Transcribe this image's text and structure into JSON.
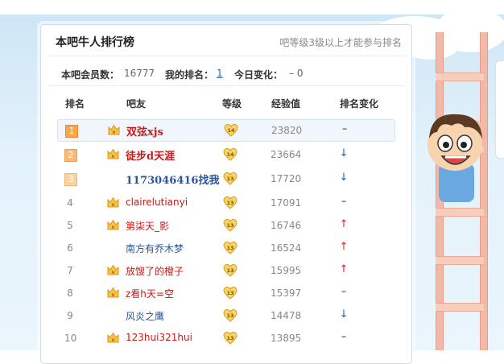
{
  "panel": {
    "title": "本吧牛人排行榜",
    "note": "吧等级3级以上才能参与排名"
  },
  "stats": {
    "members_label": "本吧会员数：",
    "members_value": "16777",
    "my_rank_label": "我的排名：",
    "my_rank_value": "1",
    "today_label": "今日变化：",
    "today_value": "– 0"
  },
  "table": {
    "headers": [
      "排名",
      "吧友",
      "等级",
      "经验值",
      "排名变化"
    ],
    "rows": [
      {
        "rank": "1",
        "name": "双弦xjs",
        "vip": true,
        "level": "14",
        "exp": "23820",
        "change": "same"
      },
      {
        "rank": "2",
        "name": "徒步d天涯",
        "vip": true,
        "level": "14",
        "exp": "23664",
        "change": "down"
      },
      {
        "rank": "3",
        "name": "1173046416找我",
        "vip": false,
        "level": "13",
        "exp": "17720",
        "change": "down"
      },
      {
        "rank": "4",
        "name": "clairelutianyi",
        "vip": true,
        "level": "13",
        "exp": "17091",
        "change": "same"
      },
      {
        "rank": "5",
        "name": "第柒天_影",
        "vip": true,
        "level": "13",
        "exp": "16746",
        "change": "up"
      },
      {
        "rank": "6",
        "name": "南方有乔木梦",
        "vip": false,
        "level": "13",
        "exp": "16524",
        "change": "up"
      },
      {
        "rank": "7",
        "name": "放馊了的橙子",
        "vip": true,
        "level": "13",
        "exp": "15995",
        "change": "up"
      },
      {
        "rank": "8",
        "name": "z看h天=空",
        "vip": true,
        "level": "13",
        "exp": "15397",
        "change": "same"
      },
      {
        "rank": "9",
        "name": "风炎之鹰",
        "vip": false,
        "level": "13",
        "exp": "14478",
        "change": "down"
      },
      {
        "rank": "10",
        "name": "123hui321hui",
        "vip": true,
        "level": "13",
        "exp": "13895",
        "change": "same"
      }
    ],
    "change_symbols": {
      "same": "–",
      "up": "↑",
      "down": "↓"
    }
  },
  "colors": {
    "vip_red": "#c81a1a",
    "plain_blue": "#2956a0",
    "badge_gold": "#f4c44a",
    "rank_orange": "#f8a64a"
  },
  "icons": {
    "vip": "vip-crown-icon",
    "level": "level-heart-badge-icon"
  }
}
